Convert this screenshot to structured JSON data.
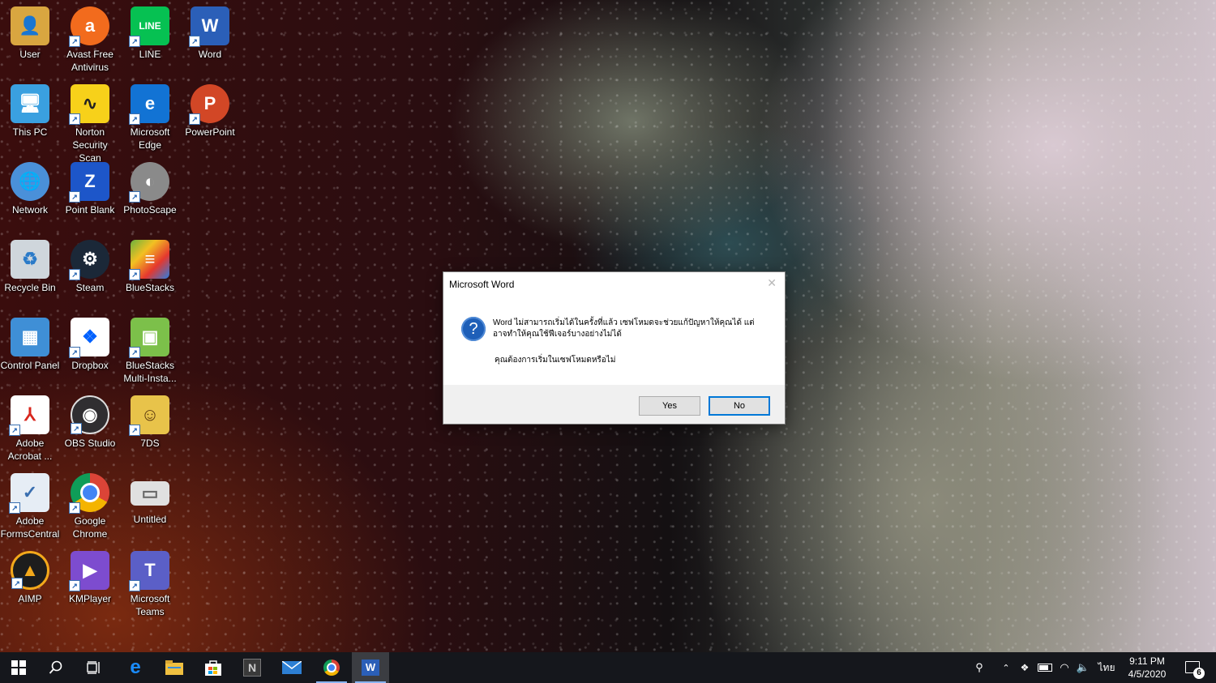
{
  "desktop": {
    "icons": [
      {
        "label": "User",
        "icon": "user-folder-icon",
        "color": "#d9a640"
      },
      {
        "label": "Avast Free Antivirus",
        "icon": "avast-icon",
        "color": "#f26b1d"
      },
      {
        "label": "LINE",
        "icon": "line-icon",
        "color": "#06c152"
      },
      {
        "label": "Word",
        "icon": "word-icon",
        "color": "#2b5fb8"
      },
      {
        "label": "This PC",
        "icon": "computer-icon",
        "color": "#3aa0e0"
      },
      {
        "label": "Norton Security Scan",
        "icon": "norton-icon",
        "color": "#f7d11a"
      },
      {
        "label": "Microsoft Edge",
        "icon": "edge-icon",
        "color": "#1273d4"
      },
      {
        "label": "PowerPoint",
        "icon": "powerpoint-icon",
        "color": "#d24726"
      },
      {
        "label": "Network",
        "icon": "network-globe-icon",
        "color": "#4a90d9"
      },
      {
        "label": "Point Blank",
        "icon": "point-blank-icon",
        "color": "#1d56c9"
      },
      {
        "label": "PhotoScape",
        "icon": "photoscape-icon",
        "color": "#8a8a8a"
      },
      {
        "label": "Recycle Bin",
        "icon": "recycle-bin-icon",
        "color": "#cfd6dc"
      },
      {
        "label": "Steam",
        "icon": "steam-icon",
        "color": "#1b2838"
      },
      {
        "label": "BlueStacks",
        "icon": "bluestacks-icon",
        "color": "#6ab23e"
      },
      {
        "label": "Control Panel",
        "icon": "control-panel-icon",
        "color": "#3f8fd6"
      },
      {
        "label": "Dropbox",
        "icon": "dropbox-icon",
        "color": "#ffffff"
      },
      {
        "label": "BlueStacks Multi-Insta...",
        "icon": "bluestacks-multi-icon",
        "color": "#7cc04a"
      },
      {
        "label": "Adobe Acrobat ...",
        "icon": "acrobat-icon",
        "color": "#ffffff"
      },
      {
        "label": "OBS Studio",
        "icon": "obs-icon",
        "color": "#302e31"
      },
      {
        "label": "7DS",
        "icon": "7ds-game-icon",
        "color": "#e8c34a"
      },
      {
        "label": "Adobe FormsCentral",
        "icon": "forms-central-icon",
        "color": "#e6edf5"
      },
      {
        "label": "Google Chrome",
        "icon": "chrome-icon",
        "color": "#4285f4"
      },
      {
        "label": "Untitled",
        "icon": "untitled-file-icon",
        "color": "#e0e0e0"
      },
      {
        "label": "AIMP",
        "icon": "aimp-icon",
        "color": "#f3a81b"
      },
      {
        "label": "KMPlayer",
        "icon": "kmplayer-icon",
        "color": "#7d4ccf"
      },
      {
        "label": "Microsoft Teams",
        "icon": "teams-icon",
        "color": "#5b5fc7"
      }
    ]
  },
  "dialog": {
    "title": "Microsoft Word",
    "message": "Word ไม่สามารถเริ่มได้ในครั้งที่แล้ว เซฟโหมดจะช่วยแก้ปัญหาให้คุณได้ แต่อาจทำให้คุณใช้ฟีเจอร์บางอย่างไม่ได้",
    "question": "คุณต้องการเริ่มในเซฟโหมดหรือไม่",
    "yes_label": "Yes",
    "no_label": "No",
    "close_glyph": "✕"
  },
  "taskbar": {
    "language": "ไทย",
    "time": "9:11 PM",
    "date": "4/5/2020",
    "notification_count": "6",
    "apps": [
      "start",
      "search",
      "task-view",
      "edge",
      "file-explorer",
      "store",
      "notion",
      "mail",
      "chrome",
      "word"
    ]
  }
}
